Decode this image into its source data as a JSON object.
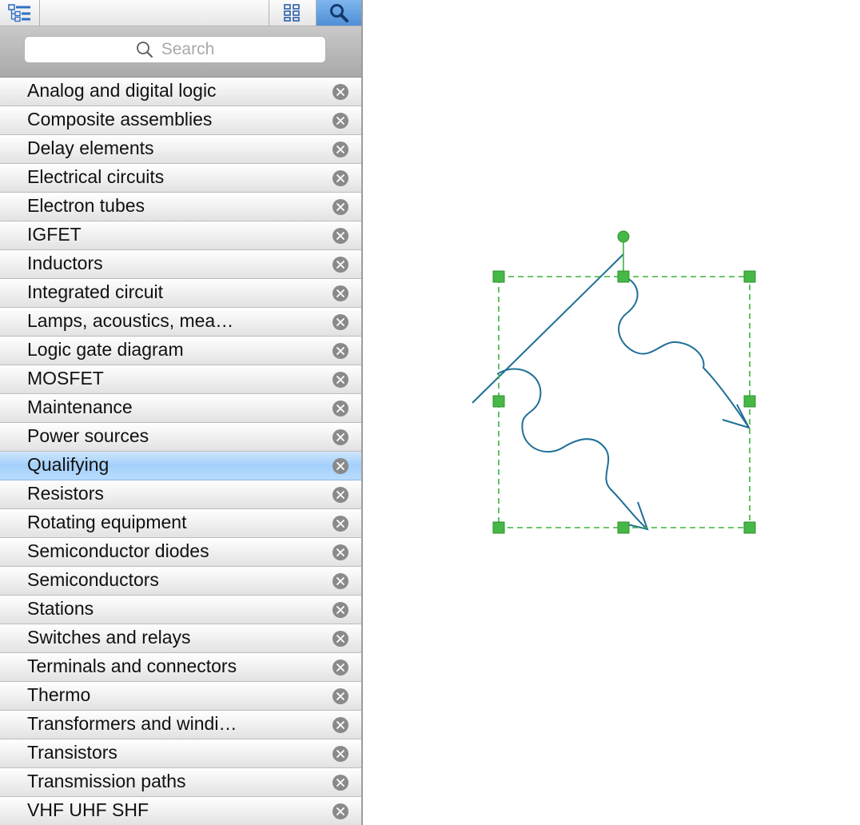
{
  "toolbar": {
    "buttons": [
      {
        "icon": "tree-view-icon"
      },
      {
        "icon": "grid-view-icon"
      },
      {
        "icon": "search-icon",
        "active": true
      }
    ]
  },
  "search": {
    "placeholder": "Search",
    "icon": "search-icon"
  },
  "libraries": [
    {
      "label": "Analog and digital logic"
    },
    {
      "label": "Composite assemblies"
    },
    {
      "label": "Delay elements"
    },
    {
      "label": "Electrical circuits"
    },
    {
      "label": "Electron tubes"
    },
    {
      "label": "IGFET"
    },
    {
      "label": "Inductors"
    },
    {
      "label": "Integrated circuit"
    },
    {
      "label": "Lamps, acoustics, mea…"
    },
    {
      "label": "Logic gate diagram"
    },
    {
      "label": "MOSFET"
    },
    {
      "label": "Maintenance"
    },
    {
      "label": "Power sources"
    },
    {
      "label": "Qualifying",
      "selected": true
    },
    {
      "label": "Resistors"
    },
    {
      "label": "Rotating equipment"
    },
    {
      "label": "Semiconductor diodes"
    },
    {
      "label": "Semiconductors"
    },
    {
      "label": "Stations"
    },
    {
      "label": "Switches and relays"
    },
    {
      "label": "Terminals and connectors"
    },
    {
      "label": "Thermo"
    },
    {
      "label": "Transformers and windi…"
    },
    {
      "label": "Transistors"
    },
    {
      "label": "Transmission paths"
    },
    {
      "label": "VHF UHF SHF"
    }
  ],
  "colors": {
    "shape_stroke": "#1f6f96",
    "selection": "#3cb43c",
    "selection_fill": "#45b845",
    "row_selected": "#a3d0fb",
    "close_badge": "#8a8a8a"
  }
}
